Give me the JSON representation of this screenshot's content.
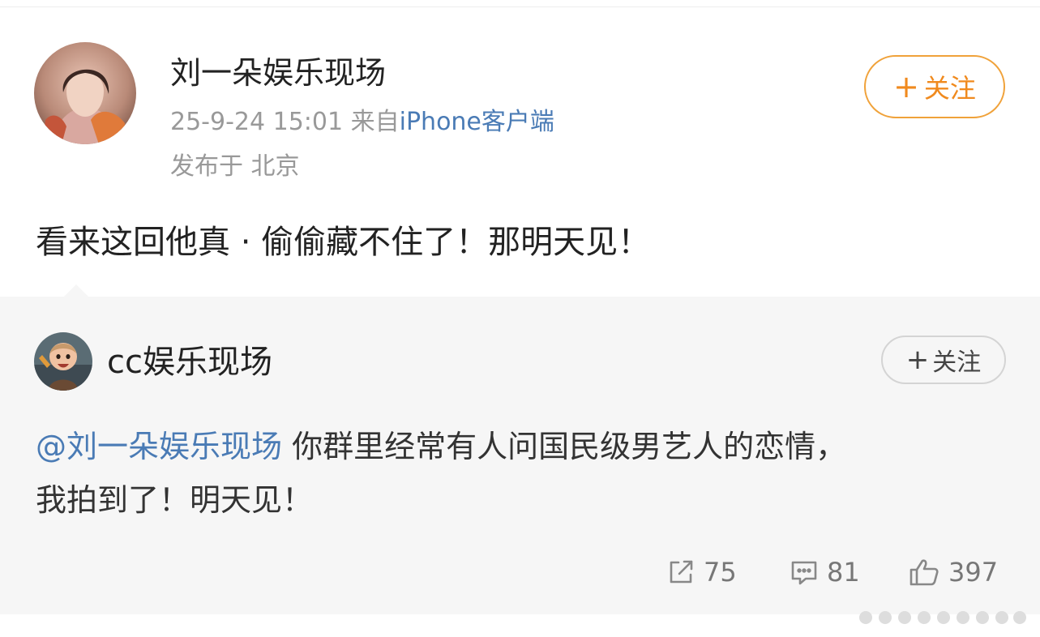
{
  "post": {
    "author_name": "刘一朵娱乐现场",
    "timestamp": "25-9-24 15:01",
    "source_prefix": "来自",
    "client": "iPhone客户端",
    "location": "发布于 北京",
    "follow_label": "关注",
    "text": "看来这回他真 · 偷偷藏不住了！那明天见！"
  },
  "quoted": {
    "author_name": "cc娱乐现场",
    "follow_label": "关注",
    "mention": "@刘一朵娱乐现场",
    "text_line1": "你群里经常有人问国民级男艺人的恋情，",
    "text_line2": "我拍到了！明天见！",
    "stats": {
      "reposts": "75",
      "comments": "81",
      "likes": "397"
    }
  },
  "icons": {
    "plus": "plus-icon",
    "repost": "repost-icon",
    "comment": "comment-icon",
    "like": "thumbs-up-icon"
  },
  "colors": {
    "follow_accent": "#f08a1e",
    "link": "#4a7bb5",
    "muted_text": "#999999",
    "quote_background": "#f6f6f6"
  }
}
